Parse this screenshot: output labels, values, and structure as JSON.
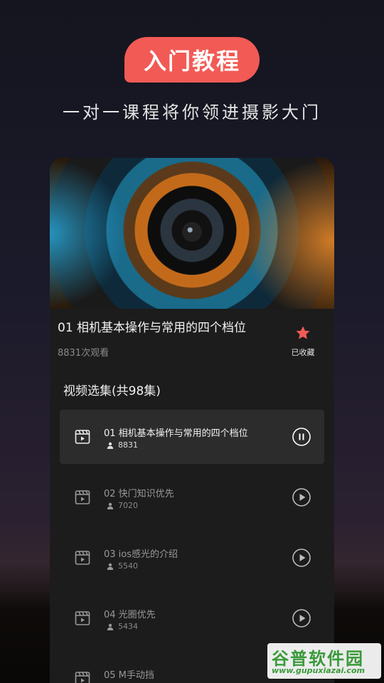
{
  "header": {
    "badge": "入门教程",
    "subtitle": "一对一课程将你领进摄影大门"
  },
  "course": {
    "title": "01 相机基本操作与常用的四个档位",
    "views": "8831次观看",
    "favorite_label": "已收藏"
  },
  "episodes_section": {
    "title": "视频选集(共98集)",
    "items": [
      {
        "title": "01 相机基本操作与常用的四个档位",
        "count": "8831",
        "state": "playing"
      },
      {
        "title": "02 快门知识优先",
        "count": "7020",
        "state": "paused"
      },
      {
        "title": "03 ios感光的介绍",
        "count": "5540",
        "state": "paused"
      },
      {
        "title": "04 光圈优先",
        "count": "5434",
        "state": "paused"
      },
      {
        "title": "05 M手动挡",
        "count": "",
        "state": "paused"
      }
    ]
  },
  "watermark": {
    "title": "谷普软件园",
    "url": "www.gupuxiazai.com"
  },
  "colors": {
    "accent": "#f25a55",
    "card_bg": "#1c1c1c",
    "active_row_bg": "#2c2c2c"
  }
}
